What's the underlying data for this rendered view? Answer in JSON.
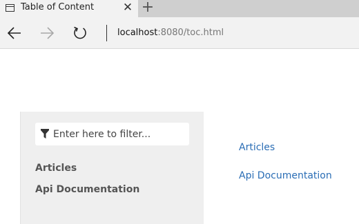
{
  "browser": {
    "tab": {
      "title": "Table of Content",
      "close_glyph": "✕",
      "new_tab_glyph": "+"
    },
    "address": {
      "host": "localhost",
      "rest": ":8080/toc.html"
    },
    "icons": {
      "tab": "page-icon",
      "back": "arrow-left-icon",
      "forward": "arrow-right-icon",
      "refresh": "refresh-icon"
    }
  },
  "sidebar": {
    "filter": {
      "placeholder": "Enter here to filter...",
      "icon": "funnel-icon"
    },
    "items": [
      {
        "label": "Articles"
      },
      {
        "label": "Api Documentation"
      }
    ]
  },
  "main": {
    "links": [
      {
        "label": "Articles"
      },
      {
        "label": "Api Documentation"
      }
    ]
  },
  "colors": {
    "link": "#2a6db5",
    "sidebar_bg": "#efefef",
    "toolbar_bg": "#f2f2f2",
    "tabbar_bg": "#cfcfcf"
  }
}
